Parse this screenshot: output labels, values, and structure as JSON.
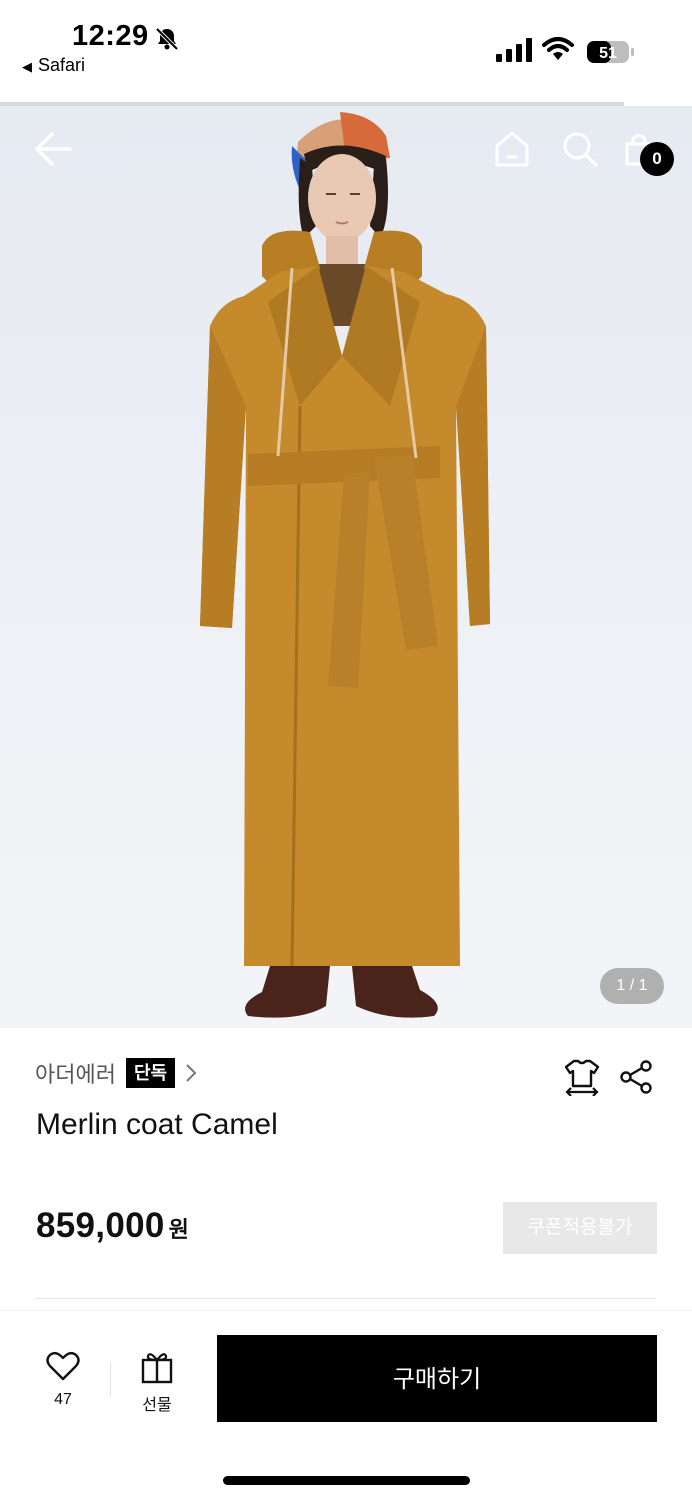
{
  "status_bar": {
    "time": "12:29",
    "back_app": "Safari",
    "battery": "51"
  },
  "header": {
    "cart_count": "0"
  },
  "gallery": {
    "pager": "1 / 1"
  },
  "product": {
    "brand": "아더에러",
    "exclusive_badge": "단독",
    "title": "Merlin coat Camel",
    "price": "859,000",
    "currency": "원",
    "coupon_label": "쿠폰적용불가"
  },
  "actions": {
    "like_count": "47",
    "gift_label": "선물",
    "buy_label": "구매하기"
  },
  "colors": {
    "accent": "#000000",
    "coat": "#c48a2c",
    "coupon_bg": "#e8e8e8"
  }
}
